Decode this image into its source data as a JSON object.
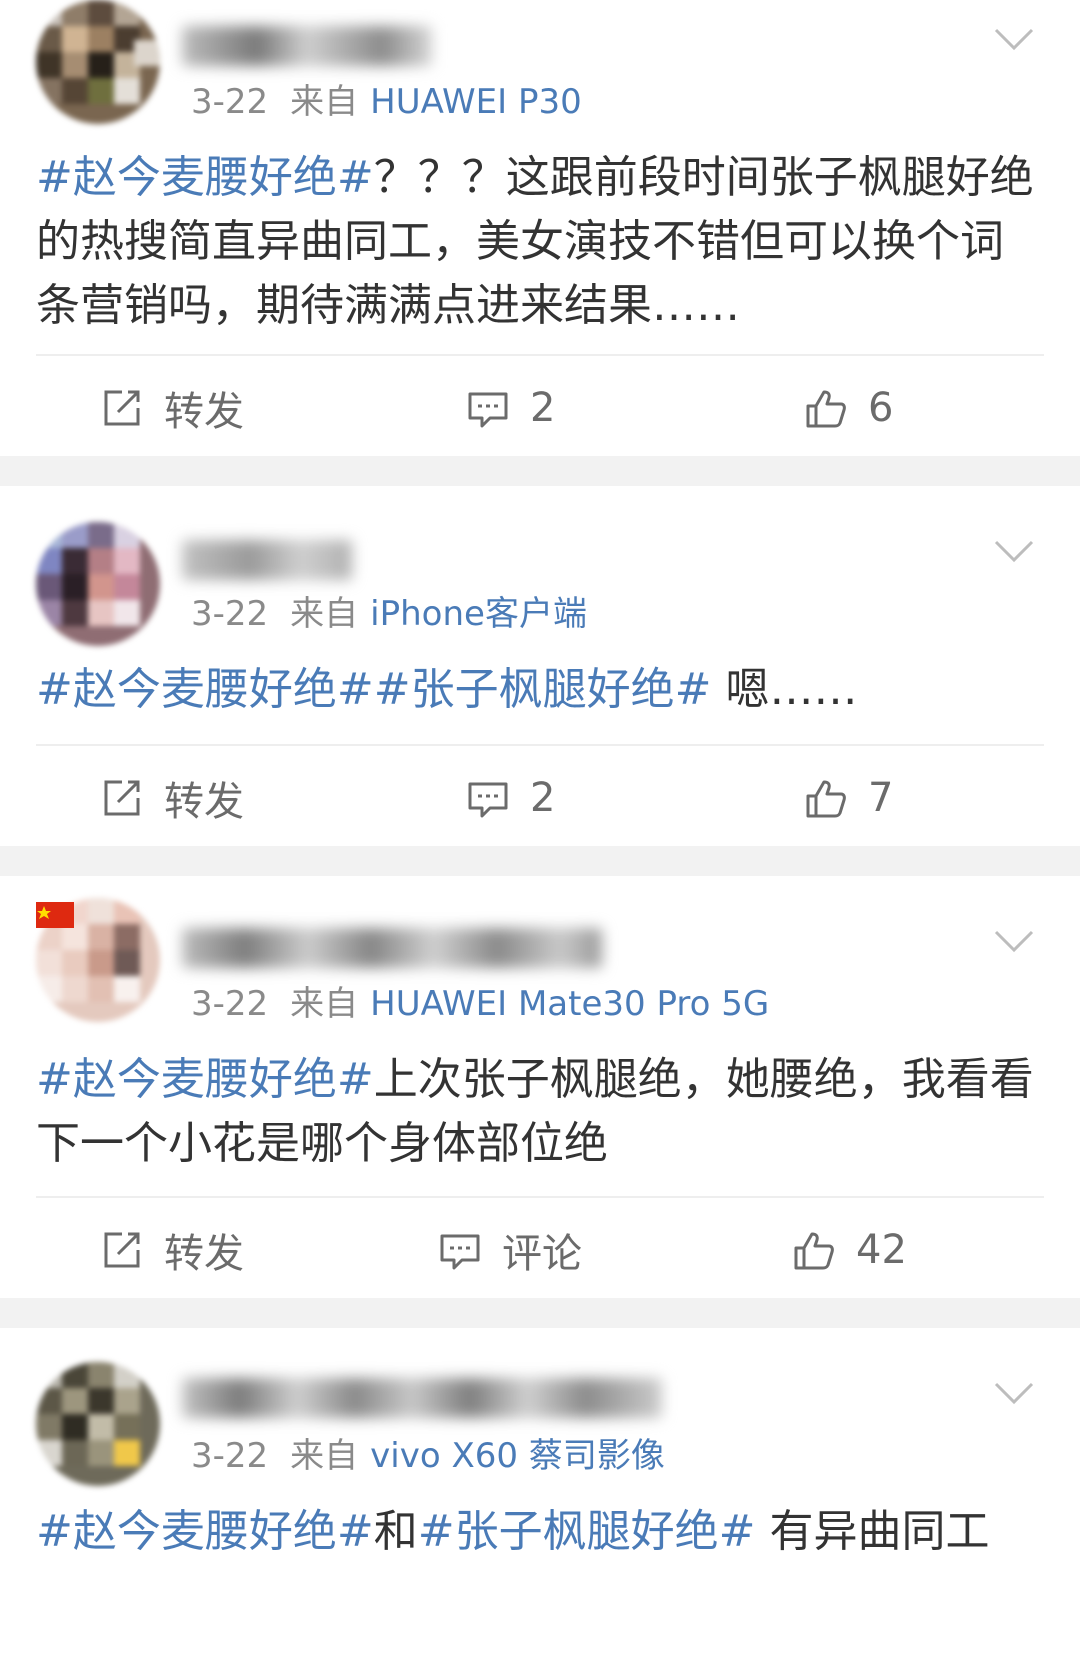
{
  "feed": {
    "posts": [
      {
        "date": "3-22",
        "from": "来自",
        "source": "HUAWEI P30",
        "segments": [
          {
            "text": "#赵今麦腰好绝#",
            "tag": true
          },
          {
            "text": "？？？这跟前段时间张子枫腿好绝的热搜简直异曲同工，美女演技不错但可以换个词条营销吗，期待满满点进来结果……",
            "tag": false
          }
        ],
        "repost_label": "转发",
        "comment_label": "2",
        "like_label": "6"
      },
      {
        "date": "3-22",
        "from": "来自",
        "source": "iPhone客户端",
        "segments": [
          {
            "text": "#赵今麦腰好绝##张子枫腿好绝#",
            "tag": true
          },
          {
            "text": " 嗯……",
            "tag": false
          }
        ],
        "repost_label": "转发",
        "comment_label": "2",
        "like_label": "7"
      },
      {
        "date": "3-22",
        "from": "来自",
        "source": "HUAWEI Mate30 Pro 5G",
        "segments": [
          {
            "text": "#赵今麦腰好绝#",
            "tag": true
          },
          {
            "text": "上次张子枫腿绝，她腰绝，我看看下一个小花是哪个身体部位绝",
            "tag": false
          }
        ],
        "repost_label": "转发",
        "comment_label": "评论",
        "like_label": "42"
      },
      {
        "date": "3-22",
        "from": "来自",
        "source": "vivo X60 蔡司影像",
        "segments": [
          {
            "text": "#赵今麦腰好绝#",
            "tag": true
          },
          {
            "text": "和",
            "tag": false
          },
          {
            "text": "#张子枫腿好绝#",
            "tag": true
          },
          {
            "text": " 有异曲同工",
            "tag": false
          }
        ]
      }
    ]
  },
  "icons": {
    "avatar": "avatar-image",
    "menu": "chevron-down-icon",
    "repost": "share-icon",
    "comment": "comment-icon",
    "like": "thumbs-up-icon"
  },
  "colors": {
    "link": "#4a7bb7",
    "text": "#333333",
    "meta": "#8a8a8a",
    "separator": "#f2f2f2"
  }
}
